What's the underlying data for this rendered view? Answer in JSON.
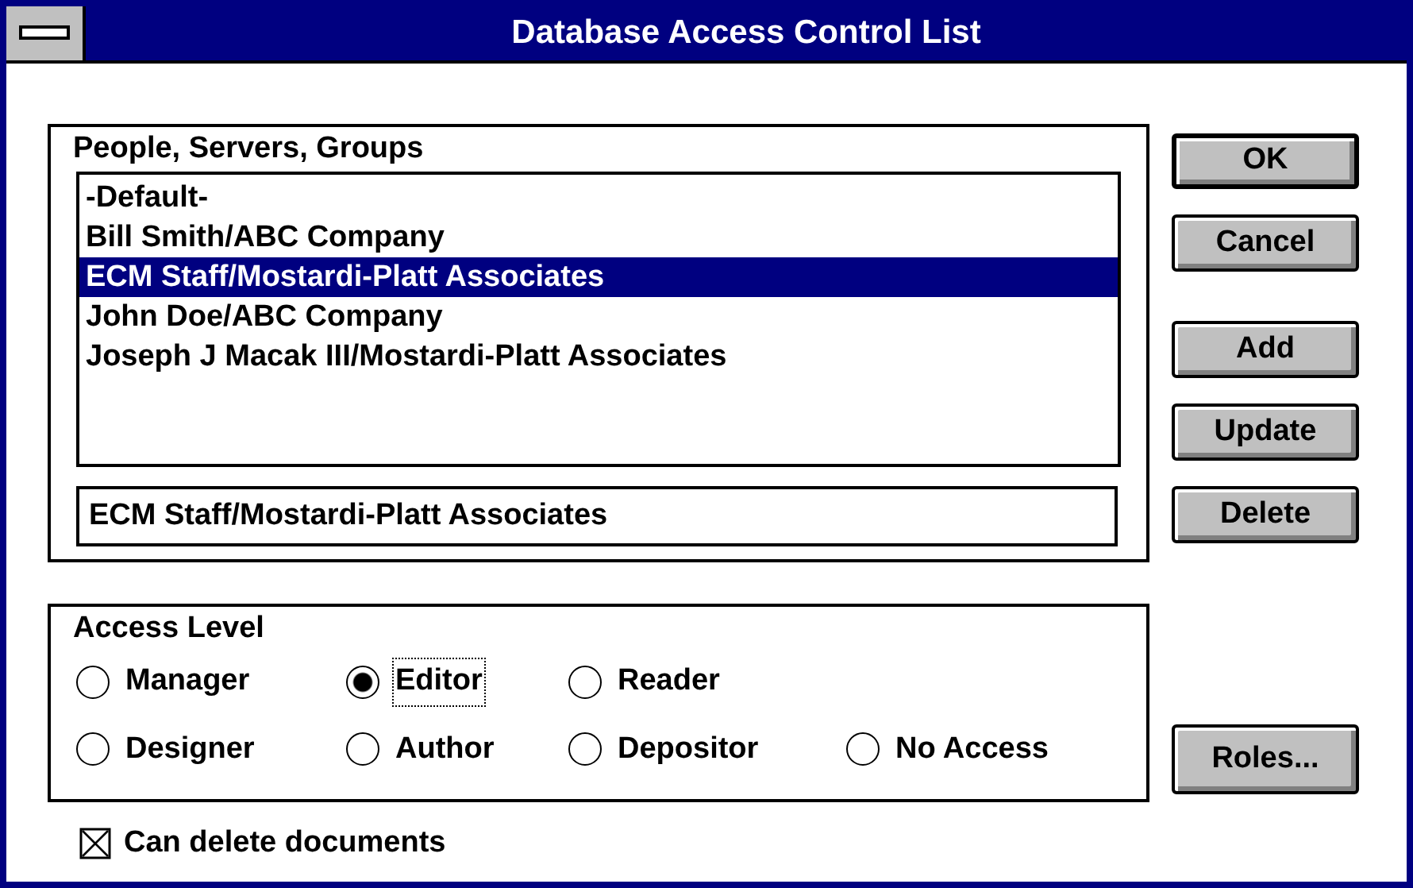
{
  "window": {
    "title": "Database Access Control List"
  },
  "people_group": {
    "label": "People, Servers, Groups",
    "items": [
      {
        "label": "-Default-",
        "selected": false
      },
      {
        "label": "Bill Smith/ABC Company",
        "selected": false
      },
      {
        "label": "ECM Staff/Mostardi-Platt Associates",
        "selected": true
      },
      {
        "label": "John Doe/ABC Company",
        "selected": false
      },
      {
        "label": "Joseph J Macak III/Mostardi-Platt Associates",
        "selected": false
      }
    ],
    "name_field": {
      "value": "ECM Staff/Mostardi-Platt Associates"
    }
  },
  "buttons": [
    {
      "label": "OK",
      "default": true
    },
    {
      "label": "Cancel",
      "default": false
    },
    {
      "label": "Add",
      "default": false
    },
    {
      "label": "Update",
      "default": false
    },
    {
      "label": "Delete",
      "default": false
    }
  ],
  "access_level": {
    "label": "Access Level",
    "options": [
      {
        "label": "Manager",
        "selected": false,
        "focused": false
      },
      {
        "label": "Editor",
        "selected": true,
        "focused": true
      },
      {
        "label": "Reader",
        "selected": false,
        "focused": false
      },
      {
        "label": "Designer",
        "selected": false,
        "focused": false
      },
      {
        "label": "Author",
        "selected": false,
        "focused": false
      },
      {
        "label": "Depositor",
        "selected": false,
        "focused": false
      },
      {
        "label": "No Access",
        "selected": false,
        "focused": false
      }
    ]
  },
  "roles_button": {
    "label": "Roles..."
  },
  "delete_checkbox": {
    "label": "Can delete documents",
    "checked": true
  }
}
